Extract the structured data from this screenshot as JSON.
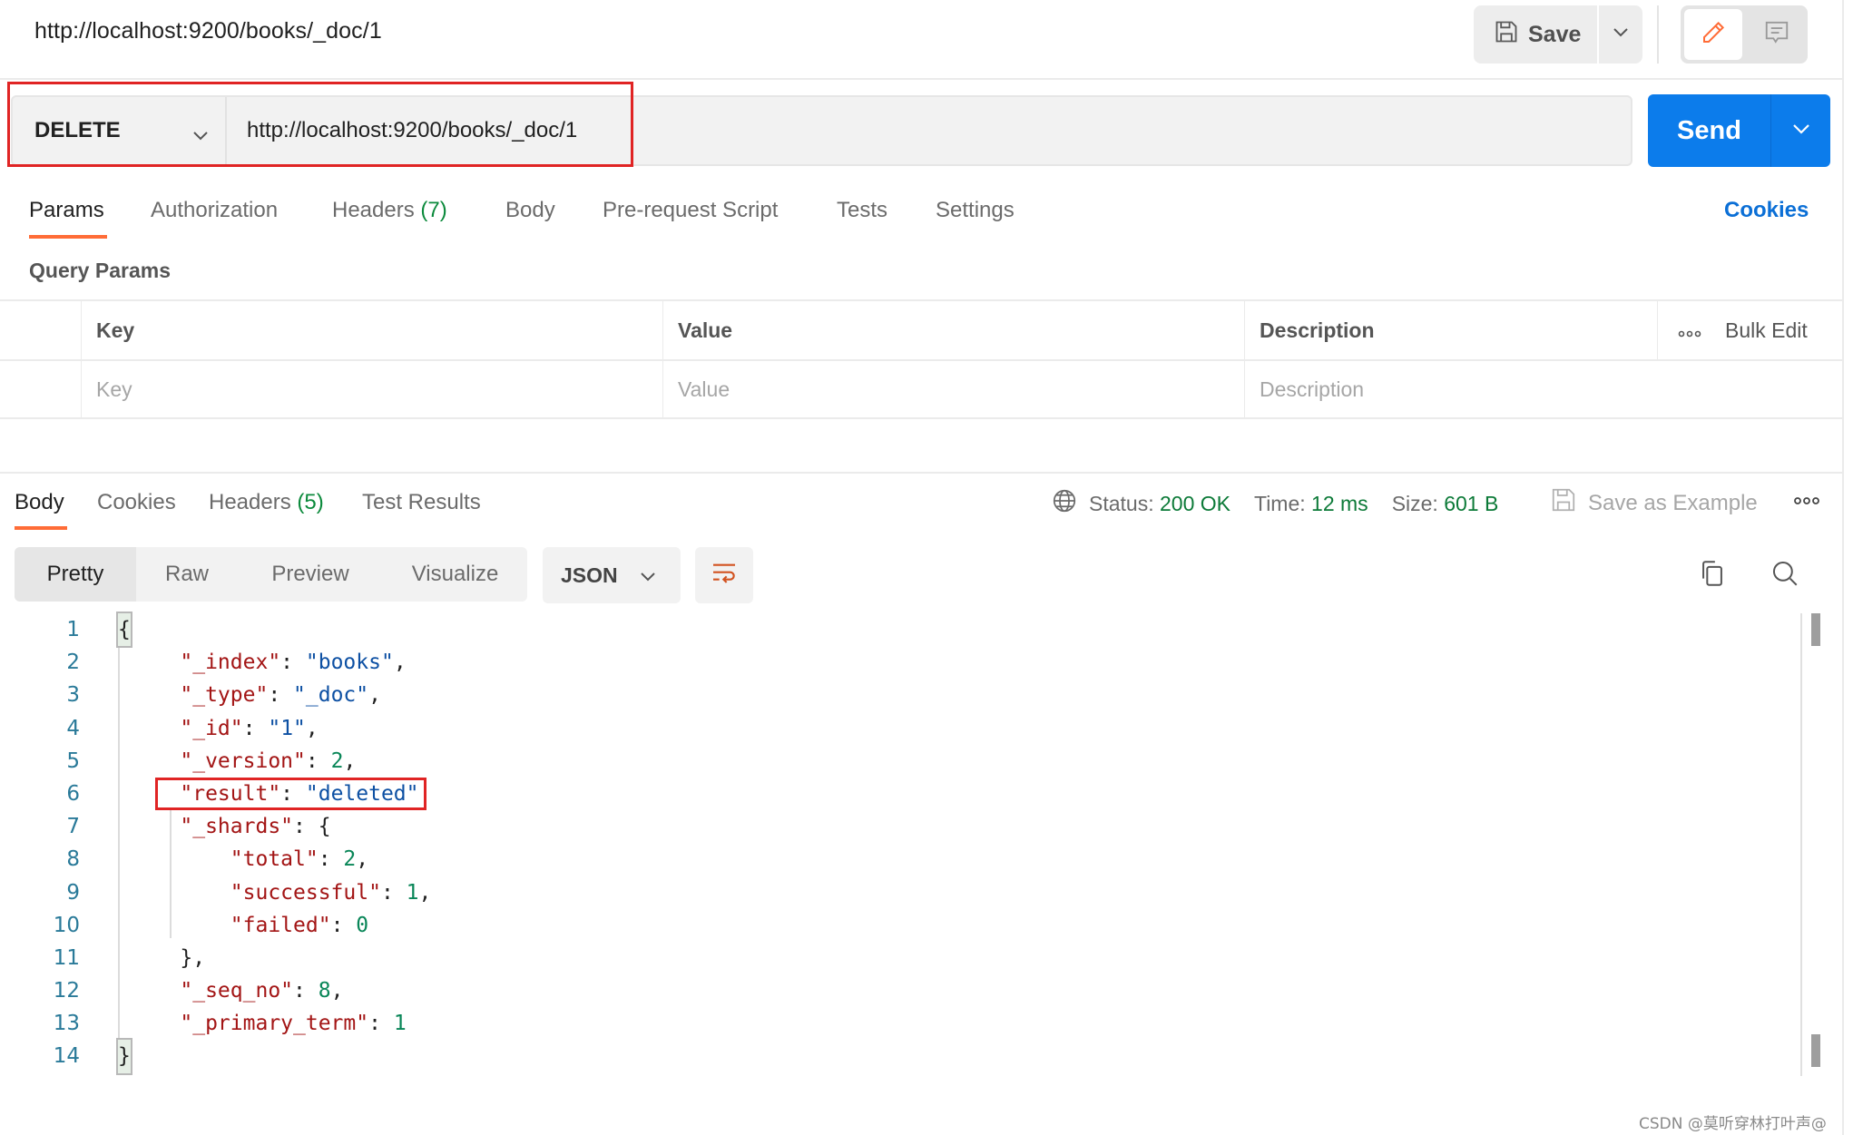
{
  "header": {
    "title": "http://localhost:9200/books/_doc/1",
    "save_label": "Save",
    "icons": {
      "save": "floppy-disk-icon",
      "caret": "chevron-down-icon",
      "edit": "pencil-icon",
      "comment": "comment-icon"
    }
  },
  "request": {
    "method": "DELETE",
    "url": "http://localhost:9200/books/_doc/1",
    "send_label": "Send",
    "tabs": [
      {
        "label": "Params",
        "active": true
      },
      {
        "label": "Authorization"
      },
      {
        "label": "Headers",
        "count": "(7)"
      },
      {
        "label": "Body"
      },
      {
        "label": "Pre-request Script"
      },
      {
        "label": "Tests"
      },
      {
        "label": "Settings"
      }
    ],
    "cookies_label": "Cookies",
    "query_params_title": "Query Params",
    "table": {
      "headers": [
        "Key",
        "Value",
        "Description"
      ],
      "placeholders": [
        "Key",
        "Value",
        "Description"
      ],
      "bulk_edit_label": "Bulk Edit"
    }
  },
  "response": {
    "tabs": [
      {
        "label": "Body",
        "active": true
      },
      {
        "label": "Cookies"
      },
      {
        "label": "Headers",
        "count": "(5)"
      },
      {
        "label": "Test Results"
      }
    ],
    "status_label": "Status:",
    "status_value": "200 OK",
    "time_label": "Time:",
    "time_value": "12 ms",
    "size_label": "Size:",
    "size_value": "601 B",
    "save_example_label": "Save as Example",
    "view_tabs": [
      "Pretty",
      "Raw",
      "Preview",
      "Visualize"
    ],
    "active_view": "Pretty",
    "format": "JSON",
    "status_color": "#0c7a38",
    "code_lines": [
      {
        "n": "1"
      },
      {
        "n": "2",
        "key": "_index",
        "str": "books",
        "comma": true
      },
      {
        "n": "3",
        "key": "_type",
        "str": "_doc",
        "comma": true
      },
      {
        "n": "4",
        "key": "_id",
        "str": "1",
        "comma": true
      },
      {
        "n": "5",
        "key": "_version",
        "num": "2",
        "comma": true
      },
      {
        "n": "6",
        "key": "result",
        "str": "deleted"
      },
      {
        "n": "7",
        "key": "_shards"
      },
      {
        "n": "8",
        "key": "total",
        "num": "2",
        "comma": true
      },
      {
        "n": "9",
        "key": "successful",
        "num": "1",
        "comma": true
      },
      {
        "n": "10",
        "key": "failed",
        "num": "0"
      },
      {
        "n": "11"
      },
      {
        "n": "12",
        "key": "_seq_no",
        "num": "8",
        "comma": true
      },
      {
        "n": "13",
        "key": "_primary_term",
        "num": "1"
      },
      {
        "n": "14"
      }
    ]
  },
  "watermark": "CSDN @莫听穿林打叶声@",
  "colors": {
    "accent": "#ff6c37",
    "send": "#0c7ceb",
    "highlight": "#e02424"
  }
}
